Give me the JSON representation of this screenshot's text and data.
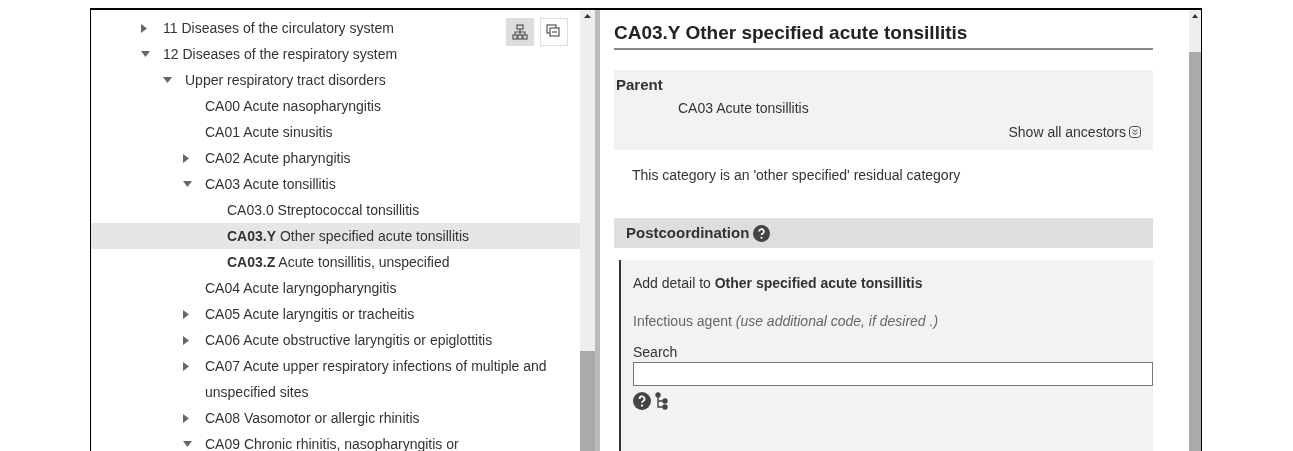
{
  "tree": {
    "toolbar": [
      {
        "kind": "hierarchy",
        "selected": true
      },
      {
        "kind": "collapse",
        "selected": false
      }
    ],
    "items": [
      {
        "label": "11 Diseases of the circulatory system",
        "kind": "branch",
        "expanded": false,
        "selected": false
      },
      {
        "label": "12 Diseases of the respiratory system",
        "kind": "branch",
        "expanded": true,
        "selected": false,
        "children": [
          {
            "label": "Upper respiratory tract disorders",
            "kind": "branch",
            "expanded": true,
            "selected": false,
            "children": [
              {
                "label": "CA00 Acute nasopharyngitis",
                "kind": "leaf",
                "selected": false
              },
              {
                "label": "CA01 Acute sinusitis",
                "kind": "leaf",
                "selected": false
              },
              {
                "label": "CA02 Acute pharyngitis",
                "kind": "branch",
                "expanded": false,
                "selected": false
              },
              {
                "label": "CA03 Acute tonsillitis",
                "kind": "branch",
                "expanded": true,
                "selected": false,
                "children": [
                  {
                    "label": "CA03.0 Streptococcal tonsillitis",
                    "kind": "leaf",
                    "selected": false
                  },
                  {
                    "label": "**CA03.Y** Other specified acute tonsillitis",
                    "kind": "leaf",
                    "selected": true
                  },
                  {
                    "label": "**CA03.Z** Acute tonsillitis, unspecified",
                    "kind": "leaf",
                    "selected": false
                  }
                ]
              },
              {
                "label": "CA04 Acute laryngopharyngitis",
                "kind": "leaf",
                "selected": false
              },
              {
                "label": "CA05 Acute laryngitis or tracheitis",
                "kind": "branch",
                "expanded": false,
                "selected": false
              },
              {
                "label": "CA06 Acute obstructive laryngitis or epiglottitis",
                "kind": "branch",
                "expanded": false,
                "selected": false
              },
              {
                "label": "CA07 Acute upper respiratory infections of multiple and unspecified sites",
                "kind": "branch",
                "expanded": false,
                "selected": false
              },
              {
                "label": "CA08 Vasomotor or allergic rhinitis",
                "kind": "branch",
                "expanded": false,
                "selected": false
              },
              {
                "label": "CA09 Chronic rhinitis, nasopharyngitis or",
                "kind": "branch",
                "expanded": true,
                "selected": false
              }
            ]
          }
        ]
      }
    ]
  },
  "detail": {
    "title": "CA03.Y Other specified acute tonsillitis",
    "parent": {
      "heading": "Parent",
      "value": "CA03 Acute tonsillitis",
      "link": "Show all ancestors"
    },
    "note": "This category is an 'other specified' residual category",
    "postcoordination": {
      "heading": "Postcoordination",
      "add_detail": "Add detail to **Other specified acute tonsillitis**",
      "axis": "Infectious agent *(use additional code, if desired .)*",
      "search_label": "Search"
    }
  }
}
